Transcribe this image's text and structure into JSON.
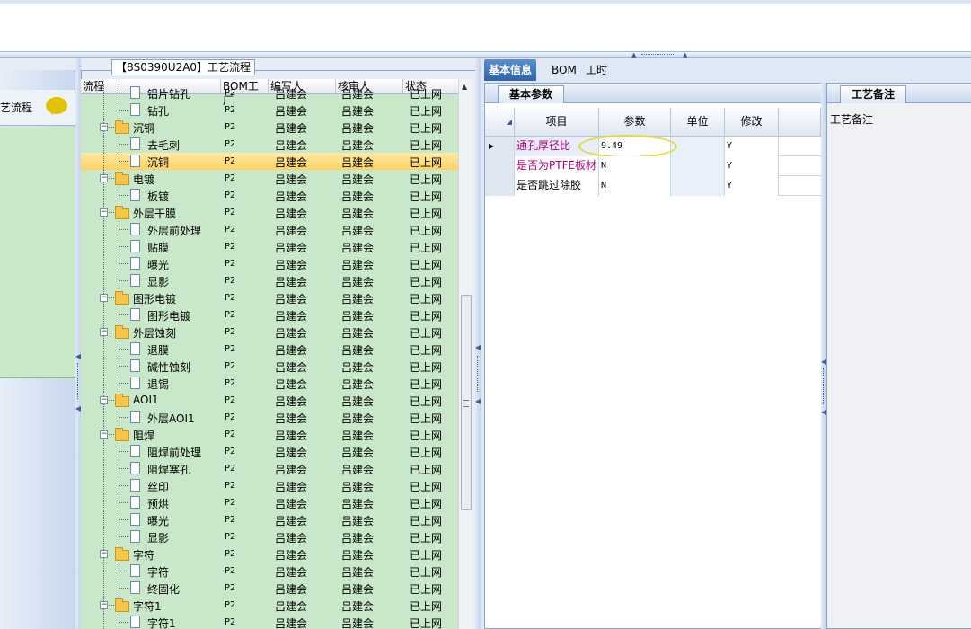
{
  "top": {},
  "left": {
    "nav_label": "艺流程",
    "group_title": "【8S0390U2A0】工艺流程",
    "columns": [
      "流程",
      "BOM工厂",
      "编写人",
      "核审人",
      "状态"
    ],
    "rows": [
      {
        "name": "铝片钻孔",
        "type": "doc",
        "level": 2,
        "factory": "P2",
        "writer": "吕建会",
        "reviewer": "吕建会",
        "status": "已上网"
      },
      {
        "name": "钻孔",
        "type": "doc",
        "level": 2,
        "factory": "P2",
        "writer": "吕建会",
        "reviewer": "吕建会",
        "status": "已上网"
      },
      {
        "name": "沉铜",
        "type": "folder",
        "level": 1,
        "factory": "P2",
        "writer": "吕建会",
        "reviewer": "吕建会",
        "status": "已上网"
      },
      {
        "name": "去毛刺",
        "type": "doc",
        "level": 2,
        "factory": "P2",
        "writer": "吕建会",
        "reviewer": "吕建会",
        "status": "已上网"
      },
      {
        "name": "沉铜",
        "type": "doc",
        "level": 2,
        "factory": "P2",
        "writer": "吕建会",
        "reviewer": "吕建会",
        "status": "已上网",
        "selected": true
      },
      {
        "name": "电镀",
        "type": "folder",
        "level": 1,
        "factory": "P2",
        "writer": "吕建会",
        "reviewer": "吕建会",
        "status": "已上网"
      },
      {
        "name": "板镀",
        "type": "doc",
        "level": 2,
        "factory": "P2",
        "writer": "吕建会",
        "reviewer": "吕建会",
        "status": "已上网"
      },
      {
        "name": "外层干膜",
        "type": "folder",
        "level": 1,
        "factory": "P2",
        "writer": "吕建会",
        "reviewer": "吕建会",
        "status": "已上网"
      },
      {
        "name": "外层前处理",
        "type": "doc",
        "level": 2,
        "factory": "P2",
        "writer": "吕建会",
        "reviewer": "吕建会",
        "status": "已上网"
      },
      {
        "name": "贴膜",
        "type": "doc",
        "level": 2,
        "factory": "P2",
        "writer": "吕建会",
        "reviewer": "吕建会",
        "status": "已上网"
      },
      {
        "name": "曝光",
        "type": "doc",
        "level": 2,
        "factory": "P2",
        "writer": "吕建会",
        "reviewer": "吕建会",
        "status": "已上网"
      },
      {
        "name": "显影",
        "type": "doc",
        "level": 2,
        "factory": "P2",
        "writer": "吕建会",
        "reviewer": "吕建会",
        "status": "已上网"
      },
      {
        "name": "图形电镀",
        "type": "folder",
        "level": 1,
        "factory": "P2",
        "writer": "吕建会",
        "reviewer": "吕建会",
        "status": "已上网"
      },
      {
        "name": "图形电镀",
        "type": "doc",
        "level": 2,
        "factory": "P2",
        "writer": "吕建会",
        "reviewer": "吕建会",
        "status": "已上网"
      },
      {
        "name": "外层蚀刻",
        "type": "folder",
        "level": 1,
        "factory": "P2",
        "writer": "吕建会",
        "reviewer": "吕建会",
        "status": "已上网"
      },
      {
        "name": "退膜",
        "type": "doc",
        "level": 2,
        "factory": "P2",
        "writer": "吕建会",
        "reviewer": "吕建会",
        "status": "已上网"
      },
      {
        "name": "碱性蚀刻",
        "type": "doc",
        "level": 2,
        "factory": "P2",
        "writer": "吕建会",
        "reviewer": "吕建会",
        "status": "已上网"
      },
      {
        "name": "退锡",
        "type": "doc",
        "level": 2,
        "factory": "P2",
        "writer": "吕建会",
        "reviewer": "吕建会",
        "status": "已上网"
      },
      {
        "name": "AOI1",
        "type": "folder",
        "level": 1,
        "factory": "P2",
        "writer": "吕建会",
        "reviewer": "吕建会",
        "status": "已上网"
      },
      {
        "name": "外层AOI1",
        "type": "doc",
        "level": 2,
        "factory": "P2",
        "writer": "吕建会",
        "reviewer": "吕建会",
        "status": "已上网"
      },
      {
        "name": "阻焊",
        "type": "folder",
        "level": 1,
        "factory": "P2",
        "writer": "吕建会",
        "reviewer": "吕建会",
        "status": "已上网"
      },
      {
        "name": "阻焊前处理",
        "type": "doc",
        "level": 2,
        "factory": "P2",
        "writer": "吕建会",
        "reviewer": "吕建会",
        "status": "已上网"
      },
      {
        "name": "阻焊塞孔",
        "type": "doc",
        "level": 2,
        "factory": "P2",
        "writer": "吕建会",
        "reviewer": "吕建会",
        "status": "已上网"
      },
      {
        "name": "丝印",
        "type": "doc",
        "level": 2,
        "factory": "P2",
        "writer": "吕建会",
        "reviewer": "吕建会",
        "status": "已上网"
      },
      {
        "name": "预烘",
        "type": "doc",
        "level": 2,
        "factory": "P2",
        "writer": "吕建会",
        "reviewer": "吕建会",
        "status": "已上网"
      },
      {
        "name": "曝光",
        "type": "doc",
        "level": 2,
        "factory": "P2",
        "writer": "吕建会",
        "reviewer": "吕建会",
        "status": "已上网"
      },
      {
        "name": "显影",
        "type": "doc",
        "level": 2,
        "factory": "P2",
        "writer": "吕建会",
        "reviewer": "吕建会",
        "status": "已上网"
      },
      {
        "name": "字符",
        "type": "folder",
        "level": 1,
        "factory": "P2",
        "writer": "吕建会",
        "reviewer": "吕建会",
        "status": "已上网"
      },
      {
        "name": "字符",
        "type": "doc",
        "level": 2,
        "factory": "P2",
        "writer": "吕建会",
        "reviewer": "吕建会",
        "status": "已上网"
      },
      {
        "name": "终固化",
        "type": "doc",
        "level": 2,
        "factory": "P2",
        "writer": "吕建会",
        "reviewer": "吕建会",
        "status": "已上网"
      },
      {
        "name": "字符1",
        "type": "folder",
        "level": 1,
        "factory": "P2",
        "writer": "吕建会",
        "reviewer": "吕建会",
        "status": "已上网"
      },
      {
        "name": "字符1",
        "type": "doc",
        "level": 2,
        "factory": "P2",
        "writer": "吕建会",
        "reviewer": "吕建会",
        "status": "已上网"
      }
    ]
  },
  "right": {
    "tabs": [
      "基本信息",
      "BOM",
      "工时"
    ],
    "panel_title": "基本参数",
    "grid_headers": [
      "项目",
      "参数",
      "单位",
      "修改"
    ],
    "grid_rows": [
      {
        "item": "通孔厚径比",
        "value": "9.49",
        "unit": "",
        "modify": "Y",
        "item_color": "#b0007a"
      },
      {
        "item": "是否为PTFE板材",
        "value": "N",
        "unit": "",
        "modify": "Y",
        "item_color": "#b0007a"
      },
      {
        "item": "是否跳过除胶",
        "value": "N",
        "unit": "",
        "modify": "Y",
        "item_color": "#000000"
      }
    ],
    "memo_title": "工艺备注",
    "memo_label": "工艺备注"
  }
}
